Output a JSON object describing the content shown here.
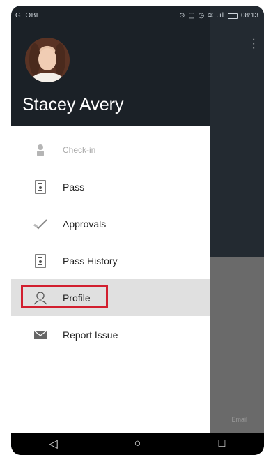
{
  "status_bar": {
    "carrier": "GLOBE",
    "icons": "⊙ ▢ ◷ ≋ .ıl",
    "time": "08:13"
  },
  "background_app": {
    "menu_icon": "kebab-icon",
    "footer_text": "Email"
  },
  "drawer": {
    "user_name": "Stacey Avery",
    "items": [
      {
        "label": "Check-in",
        "icon": "person-icon",
        "disabled": true
      },
      {
        "label": "Pass",
        "icon": "pass-icon",
        "disabled": false
      },
      {
        "label": "Approvals",
        "icon": "check-icon",
        "disabled": false
      },
      {
        "label": "Pass History",
        "icon": "pass-history-icon",
        "disabled": false
      },
      {
        "label": "Profile",
        "icon": "profile-icon",
        "disabled": false,
        "active": true
      },
      {
        "label": "Report Issue",
        "icon": "envelope-icon",
        "disabled": false
      }
    ]
  },
  "nav_bar": {
    "back": "◁",
    "home": "○",
    "recents": "□"
  },
  "colors": {
    "drawer_header": "#1b2127",
    "highlight": "#d21f2f",
    "active_row": "#e0e0e0"
  }
}
